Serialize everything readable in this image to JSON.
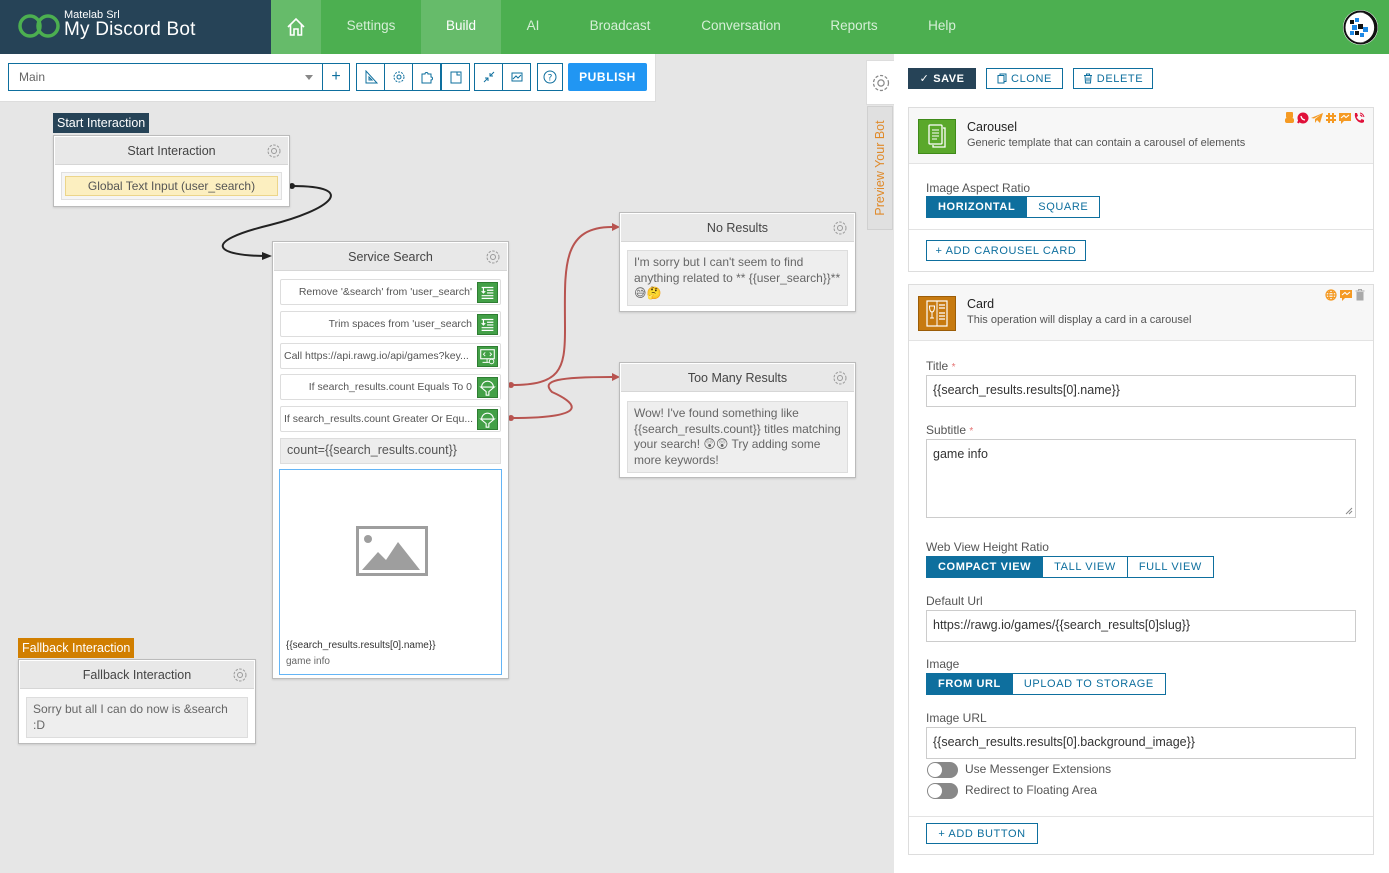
{
  "header": {
    "company": "Matelab Srl",
    "app_name": "My Discord Bot",
    "nav": [
      {
        "label": "Settings",
        "active": false
      },
      {
        "label": "Build",
        "active": true
      },
      {
        "label": "AI",
        "active": false
      },
      {
        "label": "Broadcast",
        "active": false
      },
      {
        "label": "Conversation",
        "active": false
      },
      {
        "label": "Reports",
        "active": false
      },
      {
        "label": "Help",
        "active": false
      }
    ]
  },
  "toolbar": {
    "flow_select_value": "Main",
    "add_icon": "plus-icon",
    "tools": [
      "ruler-icon",
      "gear-icon",
      "puzzle-icon",
      "note-icon",
      "compress-icon",
      "chart-icon",
      "help-icon"
    ],
    "publish_label": "PUBLISH"
  },
  "canvas": {
    "start_node": {
      "tag": "Start Interaction",
      "title": "Start Interaction",
      "trigger": "Global Text Input (user_search)"
    },
    "service_node": {
      "title": "Service Search",
      "operations": [
        {
          "label": "Remove '&search' from 'user_search'",
          "icon": "text-edit-icon"
        },
        {
          "label": "Trim spaces from 'user_search",
          "icon": "text-edit-icon"
        },
        {
          "label": "Call https://api.rawg.io/api/games?key...",
          "icon": "api-call-icon"
        },
        {
          "label": "If search_results.count Equals To 0",
          "icon": "condition-icon"
        },
        {
          "label": "If search_results.count Greater Or Equ...",
          "icon": "condition-icon"
        }
      ],
      "text_block": "count={{search_results.count}}",
      "card_preview": {
        "title": "{{search_results.results[0].name}}",
        "subtitle": "game info"
      }
    },
    "no_results_node": {
      "title": "No Results",
      "message": "I'm sorry but I can't seem to find anything related to ** {{user_search}}** 😅🤔"
    },
    "too_many_node": {
      "title": "Too Many Results",
      "message": "Wow! I've found something like {{search_results.count}} titles matching your search! 😲😲 Try adding some more keywords!"
    },
    "fallback_node": {
      "tag": "Fallback Interaction",
      "title": "Fallback Interaction",
      "message": "Sorry but all I can do now is &search :D"
    }
  },
  "side_tabs": {
    "preview_label": "Preview Your Bot"
  },
  "panel": {
    "save_label": "SAVE",
    "clone_label": "CLONE",
    "delete_label": "DELETE",
    "carousel": {
      "title": "Carousel",
      "description": "Generic template that can contain a carousel of elements",
      "channel_icons": [
        "web-chat-icon",
        "whatsapp-icon",
        "telegram-icon",
        "slack-icon",
        "messenger-icon",
        "phone-icon"
      ],
      "aspect_label": "Image Aspect Ratio",
      "aspect_options": [
        "HORIZONTAL",
        "SQUARE"
      ],
      "aspect_selected": "HORIZONTAL",
      "add_card_label": "+ ADD CAROUSEL CARD"
    },
    "card": {
      "title": "Card",
      "description": "This operation will display a card in a carousel",
      "title_label": "Title",
      "title_value": "{{search_results.results[0].name}}",
      "subtitle_label": "Subtitle",
      "subtitle_value": "game info",
      "webview_label": "Web View Height Ratio",
      "webview_options": [
        "COMPACT VIEW",
        "TALL VIEW",
        "FULL VIEW"
      ],
      "webview_selected": "COMPACT VIEW",
      "default_url_label": "Default Url",
      "default_url_value": "https://rawg.io/games/{{search_results[0]slug}}",
      "image_label": "Image",
      "image_options": [
        "FROM URL",
        "UPLOAD TO STORAGE"
      ],
      "image_selected": "FROM URL",
      "image_url_label": "Image URL",
      "image_url_value": "{{search_results.results[0].background_image}}",
      "toggles": [
        {
          "label": "Use Messenger Extensions",
          "on": false
        },
        {
          "label": "Redirect to Floating Area",
          "on": false
        }
      ],
      "add_button_label": "+ ADD BUTTON"
    }
  },
  "colors": {
    "nav_green": "#4caf50",
    "nav_active": "#66bb6a",
    "brand_dark": "#264357",
    "primary_blue": "#0e6f9e",
    "publish_blue": "#2196f3",
    "connector_red": "#b85450",
    "fallback_orange": "#d17f00",
    "carousel_green": "#5aa82b",
    "card_orange": "#c77a10"
  }
}
